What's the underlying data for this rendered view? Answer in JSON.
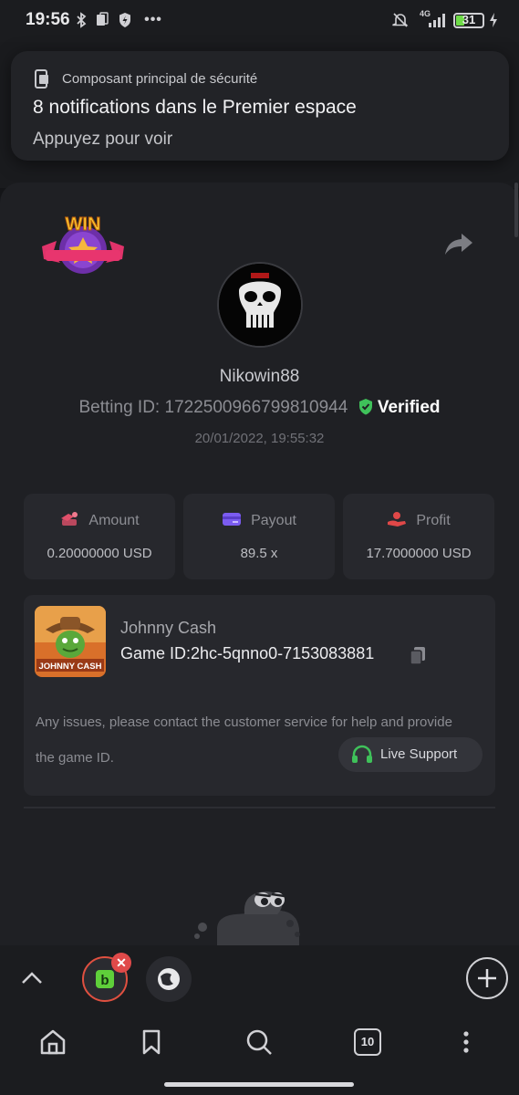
{
  "status_bar": {
    "time": "19:56",
    "network": "4G",
    "battery": "31",
    "battery_level_fraction": 0.31,
    "icons": [
      "bluetooth-icon",
      "sim-icon",
      "shield-icon",
      "more-dots-icon",
      "mute-bell-icon",
      "signal-icon",
      "battery-icon",
      "charging-icon"
    ]
  },
  "notification": {
    "app_name": "Composant principal de sécurité",
    "title": "8 notifications dans le Premier espace",
    "body": "Appuyez pour voir"
  },
  "bet": {
    "username": "Nikowin88",
    "betting_id_label": "Betting ID:",
    "betting_id": "1722500966799810944",
    "verified_label": "Verified",
    "datetime": "20/01/2022, 19:55:32",
    "stats": [
      {
        "label": "Amount",
        "value": "0.20000000 USD",
        "icon": "money-icon",
        "color": "#e0506a"
      },
      {
        "label": "Payout",
        "value": "89.5 x",
        "icon": "card-icon",
        "color": "#7b5cf0"
      },
      {
        "label": "Profit",
        "value": "17.7000000 USD",
        "icon": "hand-coin-icon",
        "color": "#e04848"
      }
    ],
    "badge_text": "WIN"
  },
  "game": {
    "name": "Johnny Cash",
    "id_label": "Game ID:",
    "id_value": "2hc-5qnno0-7153083881",
    "thumb_caption": "JOHNNY CASH",
    "issues_text": "Any issues, please contact the customer service for help and provide the game ID.",
    "support_label": "Live Support"
  },
  "tabs": {
    "count": "10"
  },
  "colors": {
    "verified_green": "#3fc15a",
    "accent_green": "#3fc15a",
    "close_red": "#e04a4a"
  }
}
